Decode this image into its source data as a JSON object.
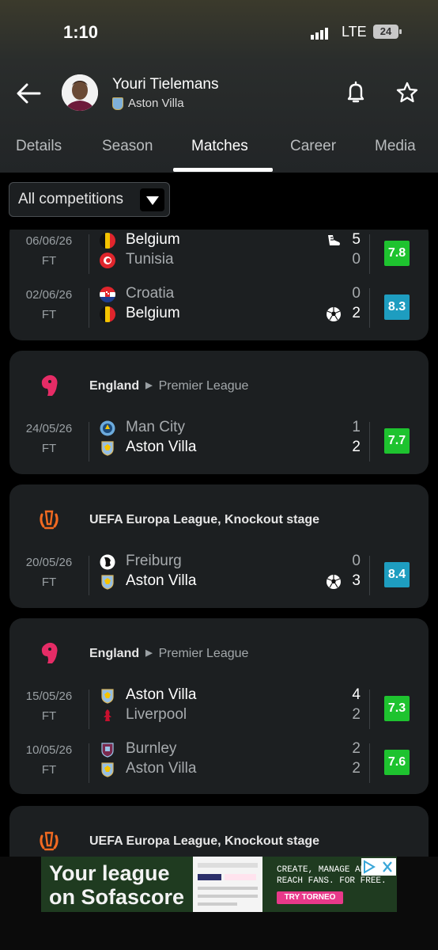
{
  "status_bar": {
    "time": "1:10",
    "network": "LTE",
    "battery": "24"
  },
  "player": {
    "name": "Youri Tielemans",
    "club": "Aston Villa"
  },
  "tabs": [
    "Details",
    "Season",
    "Matches",
    "Career",
    "Media"
  ],
  "active_tab": "Matches",
  "filter": {
    "label": "All competitions"
  },
  "cards": [
    {
      "matches": [
        {
          "date": "06/06/26",
          "status": "FT",
          "home": "Belgium",
          "away": "Tunisia",
          "home_score": "5",
          "away_score": "0",
          "rating": "7.8",
          "rating_color": "#1ec32f",
          "winner": "home",
          "event_icon": "boot-icon",
          "event_row": "home"
        },
        {
          "date": "02/06/26",
          "status": "FT",
          "home": "Croatia",
          "away": "Belgium",
          "home_score": "0",
          "away_score": "2",
          "rating": "8.3",
          "rating_color": "#1e9dc0",
          "winner": "away",
          "event_icon": "ball-icon",
          "event_row": "away"
        }
      ]
    },
    {
      "league": {
        "country": "England",
        "name": "Premier League",
        "icon": "premier-league-icon"
      },
      "matches": [
        {
          "date": "24/05/26",
          "status": "FT",
          "home": "Man City",
          "away": "Aston Villa",
          "home_score": "1",
          "away_score": "2",
          "rating": "7.7",
          "rating_color": "#1ec32f",
          "winner": "away"
        }
      ]
    },
    {
      "league": {
        "name": "UEFA Europa League, Knockout stage",
        "icon": "europa-league-icon"
      },
      "matches": [
        {
          "date": "20/05/26",
          "status": "FT",
          "home": "Freiburg",
          "away": "Aston Villa",
          "home_score": "0",
          "away_score": "3",
          "rating": "8.4",
          "rating_color": "#1e9dc0",
          "winner": "away",
          "event_icon": "ball-icon",
          "event_row": "away"
        }
      ]
    },
    {
      "league": {
        "country": "England",
        "name": "Premier League",
        "icon": "premier-league-icon"
      },
      "matches": [
        {
          "date": "15/05/26",
          "status": "FT",
          "home": "Aston Villa",
          "away": "Liverpool",
          "home_score": "4",
          "away_score": "2",
          "rating": "7.3",
          "rating_color": "#1ec32f",
          "winner": "home"
        },
        {
          "date": "10/05/26",
          "status": "FT",
          "home": "Burnley",
          "away": "Aston Villa",
          "home_score": "2",
          "away_score": "2",
          "rating": "7.6",
          "rating_color": "#1ec32f",
          "winner": "none"
        }
      ]
    },
    {
      "league": {
        "name": "UEFA Europa League, Knockout stage",
        "icon": "europa-league-icon"
      },
      "matches": []
    }
  ],
  "ad": {
    "headline_1": "Your league",
    "headline_2": "on Sofascore",
    "body_1": "CREATE, MANAGE AND",
    "body_2": "REACH FANS. FOR FREE.",
    "cta": "TRY TORNEO"
  }
}
